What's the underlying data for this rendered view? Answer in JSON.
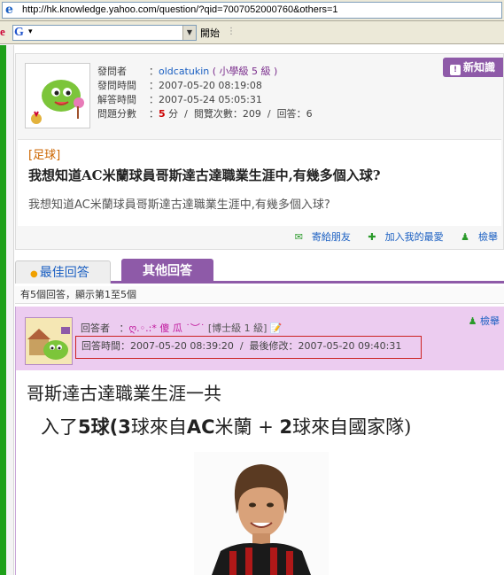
{
  "browser": {
    "url": "http://hk.knowledge.yahoo.com/question/?qid=7007052000760&others=1"
  },
  "toolbar": {
    "edge_letter": "e",
    "search_logo": "G",
    "go_label": "開始"
  },
  "question": {
    "asker_label": "發問者",
    "asker_name": "oldcatukin",
    "asker_level": "( 小學級 5 級 )",
    "asked_time_label": "發問時間",
    "asked_time": "2007-05-20 08:19:08",
    "answered_time_label": "解答時間",
    "answered_time": "2007-05-24 05:05:31",
    "points_label": "問題分數",
    "points_value": "5",
    "points_unit": "分",
    "views_label": "閱覽次數",
    "views_value": "209",
    "answers_label": "回答",
    "answers_value": "6",
    "new_knowledge_button": "新知識",
    "category": "[足球]",
    "title": "我想知道AC米蘭球員哥斯達古達職業生涯中,有幾多個入球?",
    "body": "我想知道AC米蘭球員哥斯達古達職業生涯中,有幾多個入球?",
    "actions": {
      "email": "寄給朋友",
      "favorite": "加入我的最愛",
      "report": "檢舉"
    }
  },
  "tabs": {
    "best": "最佳回答",
    "other": "其他回答"
  },
  "answers_count": "有5個回答，顯示第1至5個",
  "answer": {
    "answerer_label": "回答者",
    "answerer_name": "ღ.◦.:* 傻 瓜 ˙︶˙",
    "answerer_level": "[博士級 1 級]",
    "answer_time_label": "回答時間",
    "answer_time": "2007-05-20 08:39:20",
    "last_modified_label": "最後修改",
    "last_modified": "2007-05-20 09:40:31",
    "report": "檢舉",
    "line1": "哥斯達古達職業生涯一共",
    "line2_a": "入了",
    "line2_b": "5",
    "line2_c": "球(",
    "line2_d": "3",
    "line2_e": "球來自",
    "line2_f": "AC",
    "line2_g": "米蘭 + ",
    "line2_h": "2",
    "line2_i": "球來自國家隊)"
  }
}
